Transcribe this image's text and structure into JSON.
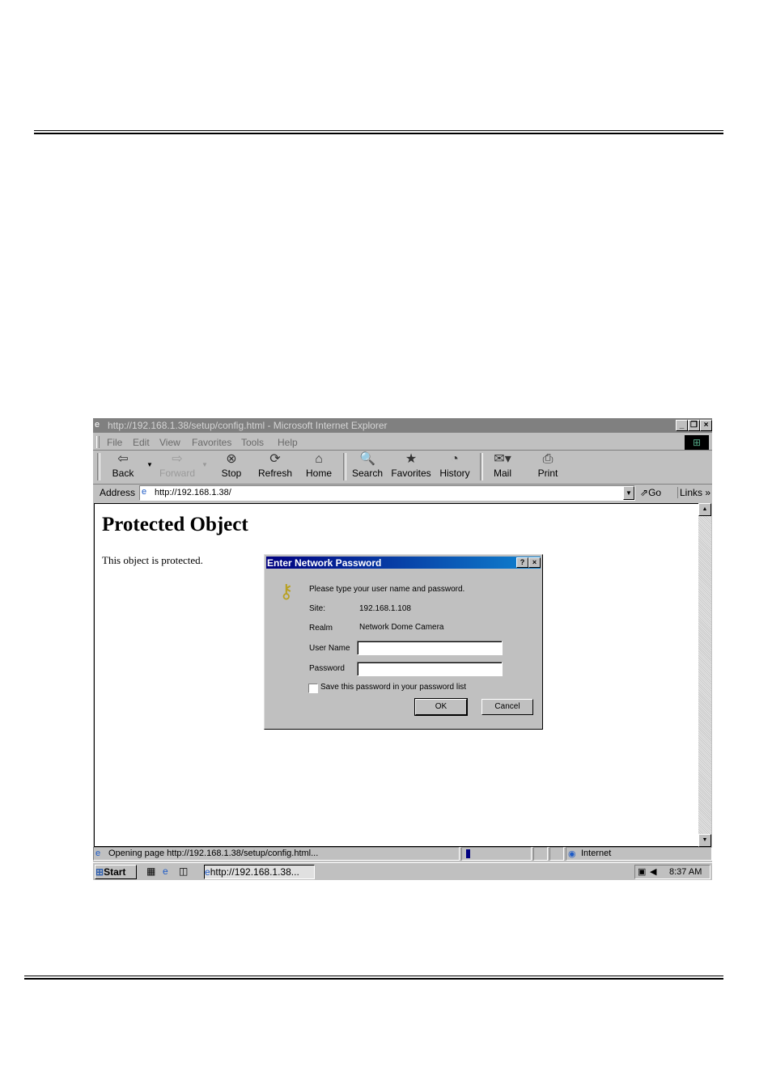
{
  "window": {
    "title": "http://192.168.1.38/setup/config.html - Microsoft Internet Explorer",
    "minimize": "_",
    "restore": "❐",
    "close": "×"
  },
  "menu": [
    "File",
    "Edit",
    "View",
    "Favorites",
    "Tools",
    "Help"
  ],
  "toolbar": {
    "back": "Back",
    "forward": "Forward",
    "stop": "Stop",
    "refresh": "Refresh",
    "home": "Home",
    "search": "Search",
    "favorites": "Favorites",
    "history": "History",
    "mail": "Mail",
    "print": "Print"
  },
  "address": {
    "label": "Address",
    "value": "http://192.168.1.38/",
    "go": "Go",
    "links": "Links"
  },
  "page": {
    "heading": "Protected Object",
    "text": "This object is protected."
  },
  "dialog": {
    "title": "Enter Network Password",
    "help": "?",
    "close": "×",
    "prompt": "Please type your user name and password.",
    "site_label": "Site:",
    "site_value": "192.168.1.108",
    "realm_label": "Realm",
    "realm_value": "Network Dome Camera",
    "user_label": "User Name",
    "user_value": "",
    "password_label": "Password",
    "password_value": "",
    "save_label": "Save this password in your password list",
    "ok": "OK",
    "cancel": "Cancel"
  },
  "status": {
    "text": "Opening page http://192.168.1.38/setup/config.html...",
    "zone": "Internet"
  },
  "taskbar": {
    "start": "Start",
    "task": "http://192.168.1.38...",
    "clock": "8:37 AM"
  },
  "icons": [
    "ie-icon",
    "back-icon",
    "forward-icon",
    "stop-icon",
    "refresh-icon",
    "home-icon",
    "search-icon",
    "favorites-icon",
    "history-icon",
    "mail-icon",
    "print-icon",
    "keys-icon",
    "globe-icon"
  ]
}
